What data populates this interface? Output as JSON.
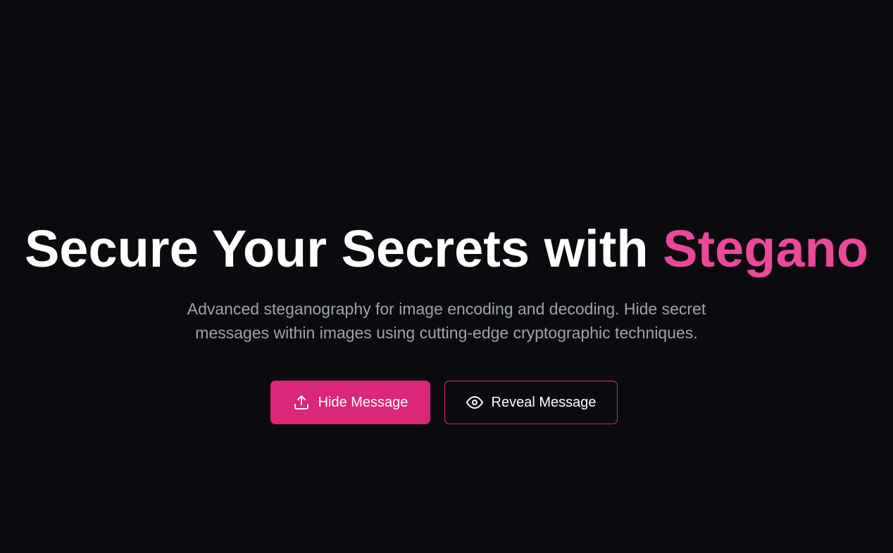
{
  "hero": {
    "title_main": "Secure Your Secrets with ",
    "title_accent": "Stegano",
    "subtitle_line1": "Advanced steganography for image encoding and decoding. Hide secret",
    "subtitle_line2": "messages within images using cutting-edge cryptographic techniques."
  },
  "actions": {
    "hide_label": "Hide Message",
    "hide_icon": "upload-icon",
    "reveal_label": "Reveal Message",
    "reveal_icon": "eye-icon"
  },
  "colors": {
    "background": "#0b0b0f",
    "accent": "#ec4899",
    "primary_button": "#db2777",
    "subtitle": "#9ca3af"
  }
}
